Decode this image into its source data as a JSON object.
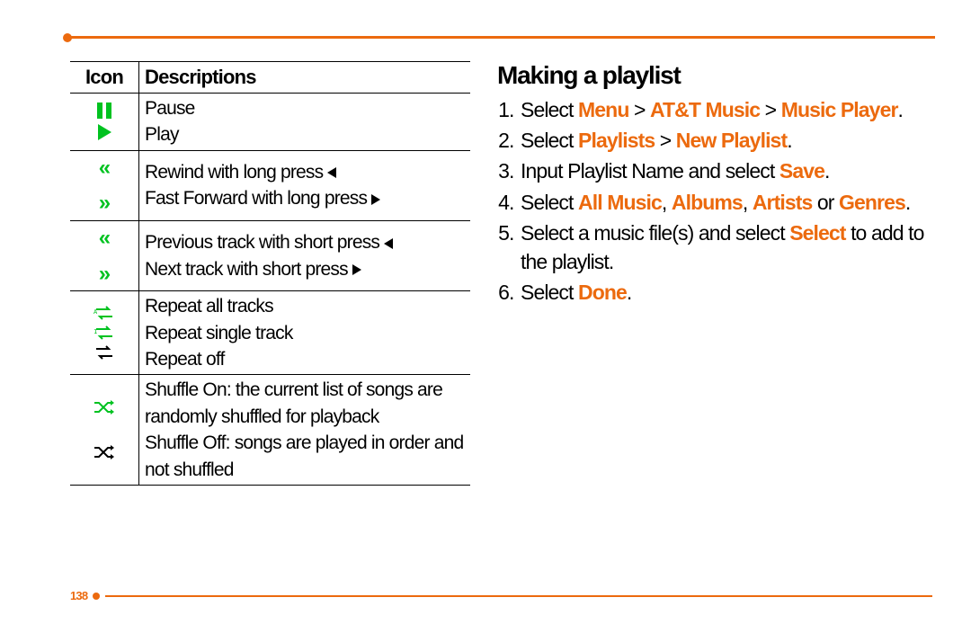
{
  "page_number": "138",
  "table": {
    "headers": {
      "icon": "Icon",
      "desc": "Descriptions"
    },
    "rows": {
      "pause": "Pause",
      "play": "Play",
      "rewind": "Rewind with long press ",
      "ff": "Fast Forward with long press ",
      "prev": "Previous track with short press ",
      "next": "Next track with short press ",
      "rep_all": "Repeat all tracks",
      "rep_one": "Repeat single track",
      "rep_off": "Repeat off",
      "sh_on": "Shuffle On: the current list of songs are randomly shuffled for playback",
      "sh_off": "Shuffle Off: songs are played in order and not shuffled"
    }
  },
  "heading": "Making a playlist",
  "steps": {
    "s1a": "Select ",
    "s1b": "Menu",
    "s1c": " > ",
    "s1d": "AT&T Music",
    "s1e": " > ",
    "s1f": "Music Player",
    "s1g": ".",
    "s2a": "Select ",
    "s2b": "Playlists",
    "s2c": " > ",
    "s2d": "New Playlist",
    "s2e": ".",
    "s3a": "Input Playlist Name and select ",
    "s3b": "Save",
    "s3c": ".",
    "s4a": "Select ",
    "s4b": "All Music",
    "s4c": ", ",
    "s4d": "Albums",
    "s4e": ", ",
    "s4f": "Artists",
    "s4g": " or ",
    "s4h": "Genres",
    "s4i": ".",
    "s5a": "Select a music file(s) and select ",
    "s5b": "Select",
    "s5c": " to add to the playlist.",
    "s6a": "Select ",
    "s6b": "Done",
    "s6c": "."
  }
}
